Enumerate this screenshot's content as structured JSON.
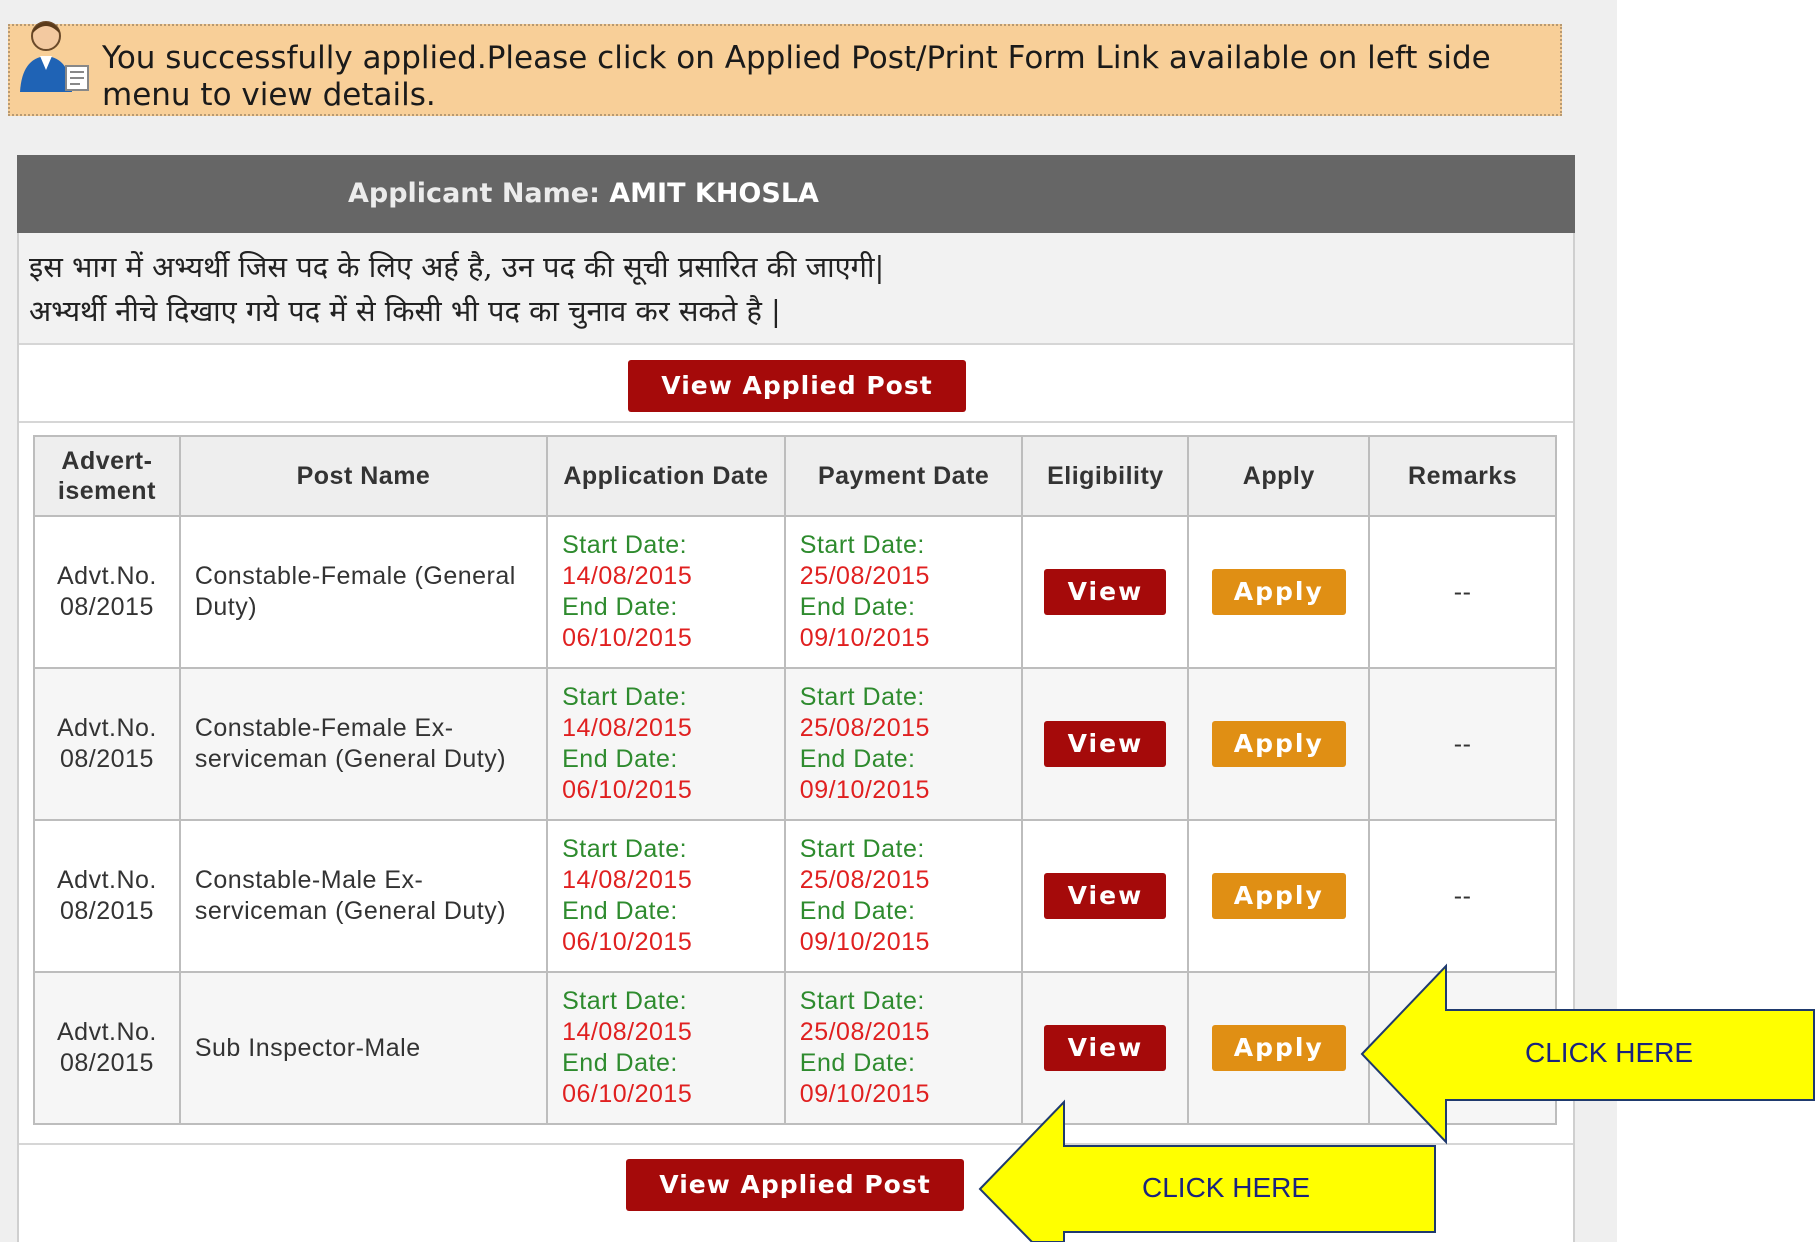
{
  "notice": {
    "message": "You successfully applied.Please click on Applied Post/Print Form Link available on left side menu to view details.",
    "icon": "user-icon"
  },
  "panel": {
    "header_label": "Applicant Name:",
    "applicant_name": "AMIT KHOSLA",
    "info_line1": "इस भाग में अभ्यर्थी जिस पद के लिए अर्ह है, उन पद की सूची प्रसारित की जाएगी|",
    "info_line2": "अभ्यर्थी नीचे दिखाए गये पद में से किसी भी पद का चुनाव कर सकते है |",
    "view_applied_post_top": "View Applied Post",
    "view_applied_post_bottom": "View Applied Post"
  },
  "table": {
    "headers": {
      "advertisement": "Advert-isement",
      "post_name": "Post Name",
      "application_date": "Application Date",
      "payment_date": "Payment Date",
      "eligibility": "Eligibility",
      "apply": "Apply",
      "remarks": "Remarks"
    },
    "rows": [
      {
        "adv_line1": "Advt.No.",
        "adv_line2": "08/2015",
        "post": "Constable-Female (General Duty)",
        "app_start_label": "Start Date:",
        "app_start": "14/08/2015",
        "app_end_label": "End Date:",
        "app_end": "06/10/2015",
        "pay_start_label": "Start Date:",
        "pay_start": "25/08/2015",
        "pay_end_label": "End Date:",
        "pay_end": "09/10/2015",
        "view": "View",
        "apply": "Apply",
        "remarks": "--"
      },
      {
        "adv_line1": "Advt.No.",
        "adv_line2": "08/2015",
        "post": "Constable-Female Ex-serviceman (General Duty)",
        "app_start_label": "Start Date:",
        "app_start": "14/08/2015",
        "app_end_label": "End Date:",
        "app_end": "06/10/2015",
        "pay_start_label": "Start Date:",
        "pay_start": "25/08/2015",
        "pay_end_label": "End Date:",
        "pay_end": "09/10/2015",
        "view": "View",
        "apply": "Apply",
        "remarks": "--"
      },
      {
        "adv_line1": "Advt.No.",
        "adv_line2": "08/2015",
        "post": "Constable-Male Ex-serviceman (General Duty)",
        "app_start_label": "Start Date:",
        "app_start": "14/08/2015",
        "app_end_label": "End Date:",
        "app_end": "06/10/2015",
        "pay_start_label": "Start Date:",
        "pay_start": "25/08/2015",
        "pay_end_label": "End Date:",
        "pay_end": "09/10/2015",
        "view": "View",
        "apply": "Apply",
        "remarks": "--"
      },
      {
        "adv_line1": "Advt.No.",
        "adv_line2": "08/2015",
        "post": "Sub Inspector-Male",
        "app_start_label": "Start Date:",
        "app_start": "14/08/2015",
        "app_end_label": "End Date:",
        "app_end": "06/10/2015",
        "pay_start_label": "Start Date:",
        "pay_start": "25/08/2015",
        "pay_end_label": "End Date:",
        "pay_end": "09/10/2015",
        "view": "View",
        "apply": "Apply",
        "remarks": ""
      }
    ]
  },
  "callouts": {
    "apply_arrow_label": "CLICK HERE",
    "view_arrow_label": "CLICK HERE",
    "color": "#ffff00"
  },
  "colors": {
    "red_button": "#a50a0a",
    "orange_button": "#e08f14",
    "header_bar": "#666666",
    "notice_bg": "#f8cf98",
    "date_label": "#2e8b2e",
    "date_value": "#e02020"
  }
}
